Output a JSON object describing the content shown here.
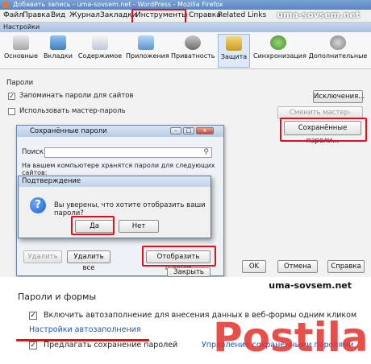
{
  "browser": {
    "window_title": "Добавить запись - uma-sovsem.net - WordPress - Mozilla Firefox",
    "menu": [
      "Файл",
      "Правка",
      "Вид",
      "Журнал",
      "Закладки",
      "Инструменты",
      "Справка",
      "Related Links"
    ],
    "highlighted_menu": "Инструменты",
    "watermark": "uma-sovsem.net"
  },
  "prefs": {
    "title": "Настройки",
    "tabs": [
      "Основные",
      "Вкладки",
      "Содержимое",
      "Приложения",
      "Приватность",
      "Защита",
      "Синхронизация",
      "Дополнительные"
    ],
    "active_tab": "Защита",
    "section": "Пароли",
    "remember_passwords": "Запоминать пароли для сайтов",
    "use_master_password": "Использовать мастер-пароль",
    "exceptions_button": "Исключения...",
    "change_master_button": "Сменить мастер-пароль...",
    "saved_passwords_button": "Сохранённые пароли...",
    "ok_button": "OK",
    "cancel_button": "Отмена",
    "help_button": "Справка"
  },
  "saved_dialog": {
    "title": "Сохранённые пароли",
    "search_label": "Поиск:",
    "info_text": "На вашем компьютере хранятся пароли для следующих сайтов:",
    "delete_button": "Удалить",
    "delete_all_button": "Удалить все",
    "show_passwords_button": "Отобразить пароли",
    "close_button": "Закрыть"
  },
  "confirm_dialog": {
    "title": "Подтверждение",
    "question": "Вы уверены, что хотите отобразить ваши пароли?",
    "yes_button": "Да",
    "no_button": "Нет"
  },
  "forms_section": {
    "watermark": "uma-sovsem.net",
    "title": "Пароли и формы",
    "autofill_text": "Включить автозаполнение для внесения данных в веб-формы одним кликом",
    "autofill_settings_link": "Настройки автозаполнения",
    "offer_save_text": "Предлагать сохранение паролей",
    "manage_link": "Управление сохранёнными паролями",
    "logo_text": "Postila.ru"
  },
  "colors": {
    "highlight_red": "#e0101a",
    "link_blue": "#1a55b8",
    "logo_red": "#e4302b"
  }
}
